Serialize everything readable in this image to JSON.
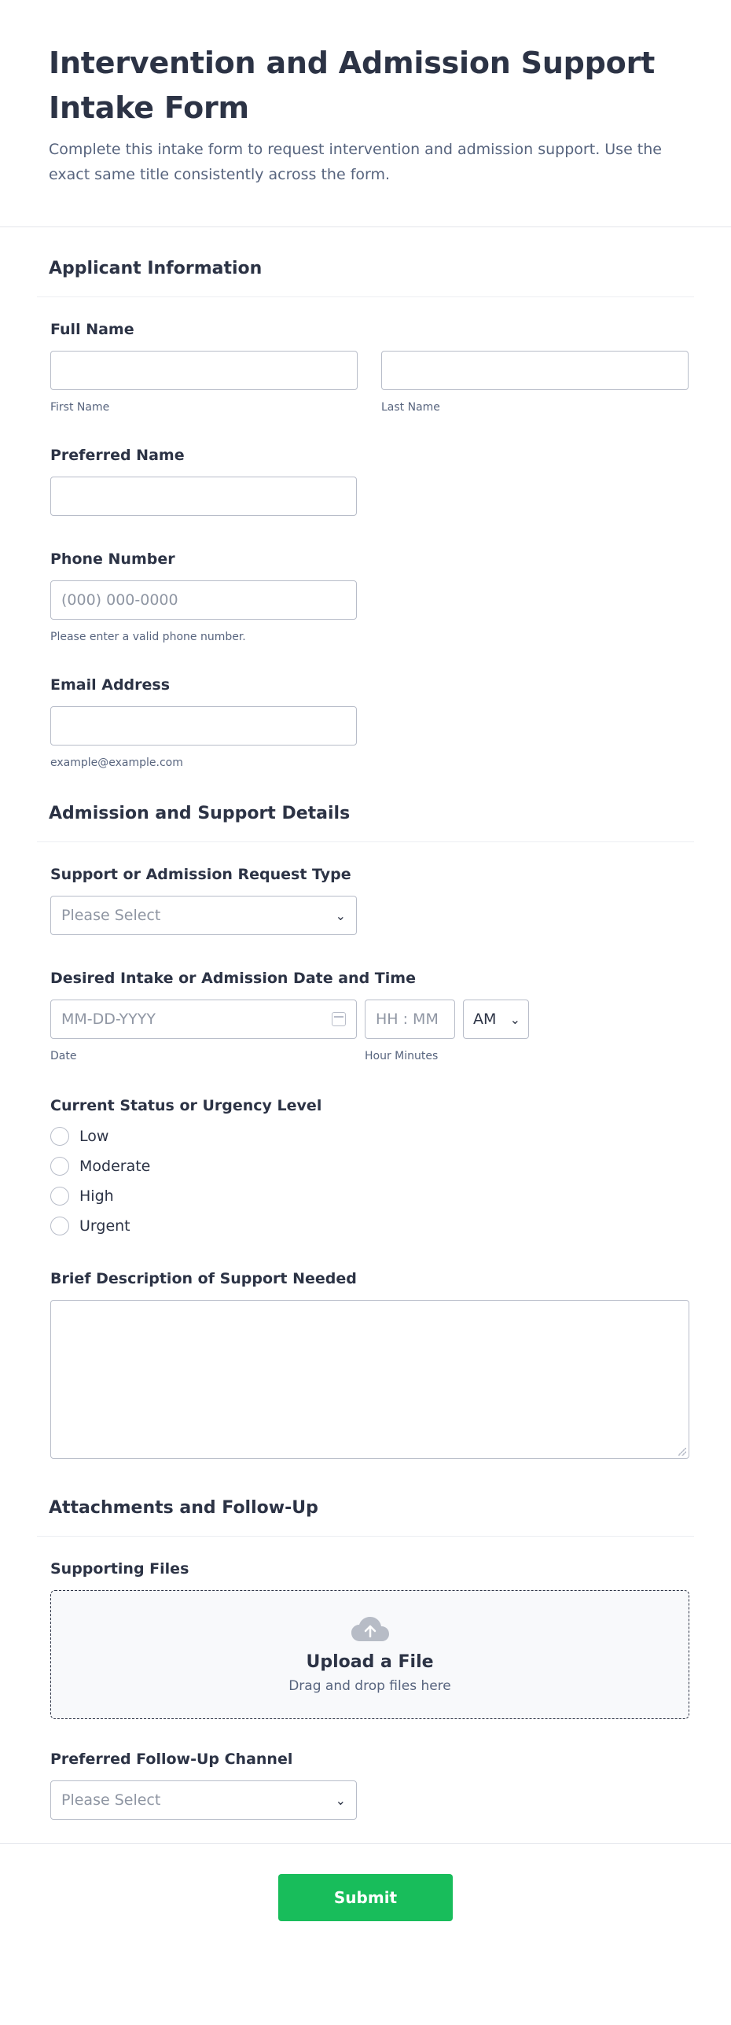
{
  "header": {
    "title": "Intervention and Admission Support Intake Form",
    "description": "Complete this intake form to request intervention and admission support. Use the exact same title consistently across the form."
  },
  "sections": {
    "applicant": {
      "title": "Applicant Information",
      "full_name": {
        "label": "Full Name",
        "first_sublabel": "First Name",
        "last_sublabel": "Last Name"
      },
      "preferred_name": {
        "label": "Preferred Name"
      },
      "phone": {
        "label": "Phone Number",
        "placeholder": "(000) 000-0000",
        "sublabel": "Please enter a valid phone number."
      },
      "email": {
        "label": "Email Address",
        "sublabel": "example@example.com"
      }
    },
    "admission": {
      "title": "Admission and Support Details",
      "request_type": {
        "label": "Support or Admission Request Type",
        "placeholder": "Please Select"
      },
      "datetime": {
        "label": "Desired Intake or Admission Date and Time",
        "date_placeholder": "MM-DD-YYYY",
        "date_sublabel": "Date",
        "time_placeholder": "HH : MM",
        "time_sublabel": "Hour Minutes",
        "ampm": "AM"
      },
      "urgency": {
        "label": "Current Status or Urgency Level",
        "options": [
          "Low",
          "Moderate",
          "High",
          "Urgent"
        ]
      },
      "description": {
        "label": "Brief Description of Support Needed"
      }
    },
    "attachments": {
      "title": "Attachments and Follow-Up",
      "files": {
        "label": "Supporting Files",
        "upload_title": "Upload a File",
        "upload_sub": "Drag and drop files here"
      },
      "followup": {
        "label": "Preferred Follow-Up Channel",
        "placeholder": "Please Select"
      }
    }
  },
  "submit_label": "Submit",
  "colors": {
    "accent": "#18bd5b",
    "text": "#2c3345",
    "muted": "#57647e",
    "border": "#b8bdc9"
  },
  "icons": {
    "calendar": "calendar-icon",
    "chevron": "chevron-down-icon",
    "upload": "cloud-upload-icon"
  }
}
